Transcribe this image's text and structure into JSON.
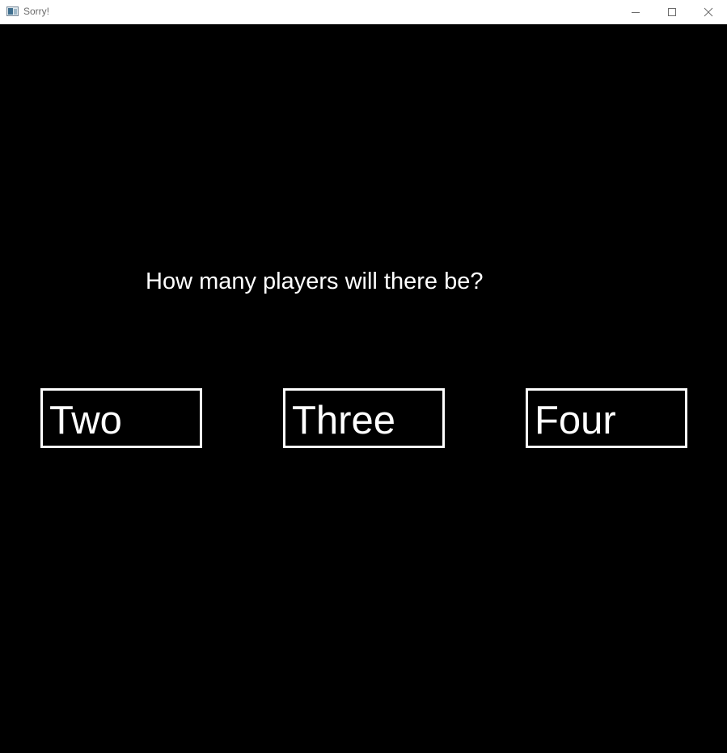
{
  "window": {
    "title": "Sorry!",
    "app_icon": "window-app-icon",
    "controls": {
      "minimize_icon": "minimize-icon",
      "maximize_icon": "maximize-icon",
      "close_icon": "close-icon"
    }
  },
  "screen": {
    "background_color": "#000000",
    "text_color": "#ffffff",
    "question": "How many players will there be?",
    "choices": [
      {
        "label": "Two"
      },
      {
        "label": "Three"
      },
      {
        "label": "Four"
      }
    ]
  }
}
